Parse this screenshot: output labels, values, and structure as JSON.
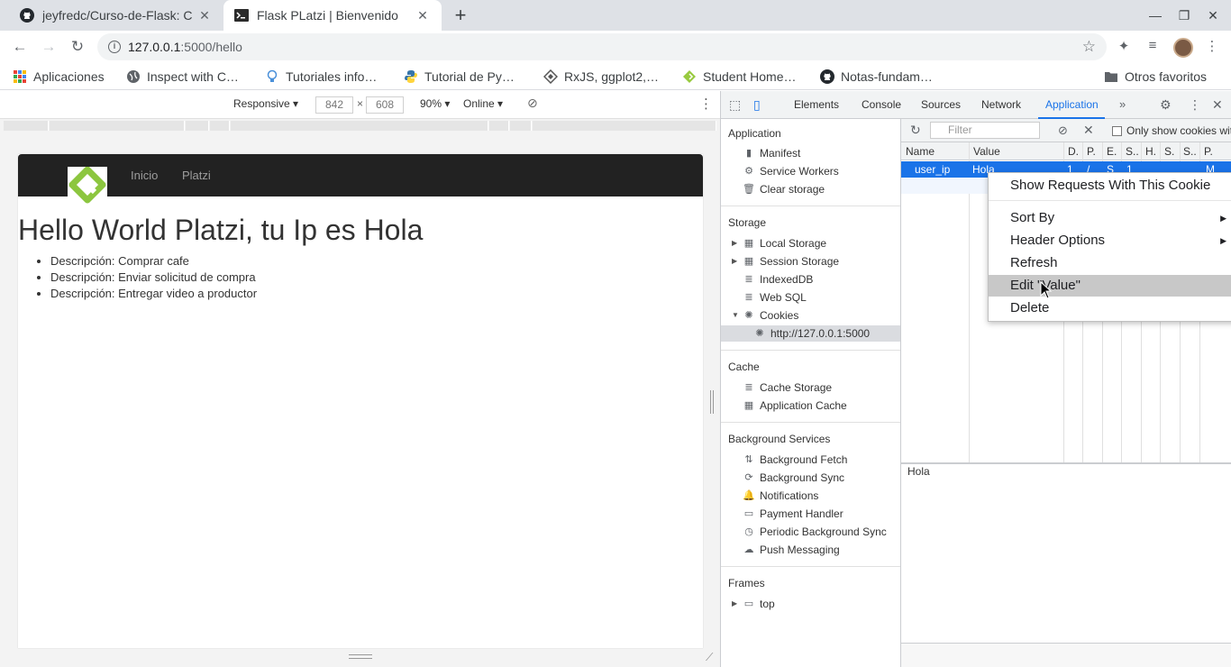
{
  "tabs": [
    {
      "title": "jeyfredc/Curso-de-Flask: C",
      "active": false
    },
    {
      "title": "Flask PLatzi | Bienvenido",
      "active": true
    }
  ],
  "omnibox": {
    "host": "127.0.0.1",
    "path": ":5000/hello"
  },
  "bookmarks": [
    {
      "label": "Aplicaciones",
      "icon": "apps-grid-icon"
    },
    {
      "label": "Inspect with C…",
      "icon": "globe-icon"
    },
    {
      "label": "Tutoriales info…",
      "icon": "bulb-icon"
    },
    {
      "label": "Tutorial de Py…",
      "icon": "python-icon"
    },
    {
      "label": "RxJS, ggplot2,…",
      "icon": "diamond-icon"
    },
    {
      "label": "Student Home…",
      "icon": "leaf-icon"
    },
    {
      "label": "Notas-fundam…",
      "icon": "github-icon"
    }
  ],
  "other_bookmarks": "Otros favoritos",
  "device_toolbar": {
    "mode": "Responsive",
    "width": "842",
    "times": "×",
    "height": "608",
    "zoom": "90%",
    "network": "Online"
  },
  "page": {
    "nav": [
      "Inicio",
      "Platzi"
    ],
    "heading": "Hello World Platzi, tu Ip es Hola",
    "items": [
      "Descripción: Comprar cafe",
      "Descripción: Enviar solicitud de compra",
      "Descripción: Entregar video a productor"
    ]
  },
  "devtools": {
    "tabs": [
      "Elements",
      "Console",
      "Sources",
      "Network",
      "Application"
    ],
    "active_tab": "Application",
    "sidebar": {
      "application_title": "Application",
      "application_items": [
        "Manifest",
        "Service Workers",
        "Clear storage"
      ],
      "storage_title": "Storage",
      "storage_items": [
        "Local Storage",
        "Session Storage",
        "IndexedDB",
        "Web SQL",
        "Cookies"
      ],
      "cookie_origin": "http://127.0.0.1:5000",
      "cache_title": "Cache",
      "cache_items": [
        "Cache Storage",
        "Application Cache"
      ],
      "background_title": "Background Services",
      "background_items": [
        "Background Fetch",
        "Background Sync",
        "Notifications",
        "Payment Handler",
        "Periodic Background Sync",
        "Push Messaging"
      ],
      "frames_title": "Frames",
      "frames_items": [
        "top"
      ]
    },
    "cookies": {
      "filter_placeholder": "Filter",
      "only_show_label": "Only show cookies wit",
      "columns": [
        "Name",
        "Value",
        "D.",
        "P.",
        "E.",
        "S..",
        "H.",
        "S.",
        "S..",
        "P."
      ],
      "row": {
        "name": "user_ip",
        "value": "Hola",
        "d": "1",
        "p": "/",
        "e": "S",
        "s": "1",
        "p2": "M"
      },
      "detail_value": "Hola"
    }
  },
  "context_menu": {
    "items": [
      "Show Requests With This Cookie",
      "Sort By",
      "Header Options",
      "Refresh",
      "Edit \"Value\"",
      "Delete"
    ],
    "hovered": "Edit \"Value\""
  },
  "colors": {
    "accent": "#1a73e8",
    "navbar": "#222222",
    "logo_green": "#8cc63f"
  }
}
